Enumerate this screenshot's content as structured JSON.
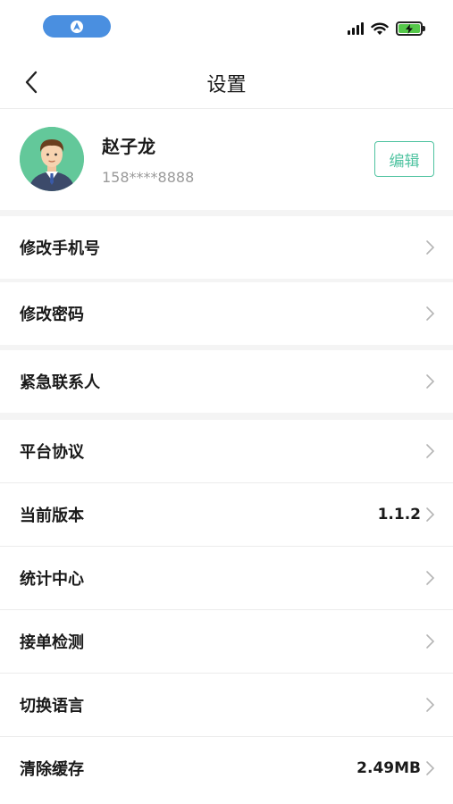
{
  "header": {
    "title": "设置"
  },
  "profile": {
    "name": "赵子龙",
    "phone": "158****8888",
    "edit_label": "编辑"
  },
  "menu": {
    "items": [
      {
        "label": "修改手机号",
        "value": ""
      },
      {
        "label": "修改密码",
        "value": ""
      },
      {
        "label": "紧急联系人",
        "value": ""
      },
      {
        "label": "平台协议",
        "value": ""
      },
      {
        "label": "当前版本",
        "value": "1.1.2"
      },
      {
        "label": "统计中心",
        "value": ""
      },
      {
        "label": "接单检测",
        "value": ""
      },
      {
        "label": "切换语言",
        "value": ""
      },
      {
        "label": "清除缓存",
        "value": "2.49MB"
      }
    ]
  },
  "colors": {
    "accent": "#4fc3a0",
    "status_pill": "#4a8fe0",
    "battery": "#55c84a",
    "avatar_bg": "#63c89a"
  },
  "icons": {
    "back": "chevron-left-icon",
    "row_arrow": "chevron-right-icon",
    "location": "location-arrow-icon",
    "signal": "cellular-signal-icon",
    "wifi": "wifi-icon",
    "battery": "battery-charging-icon"
  }
}
